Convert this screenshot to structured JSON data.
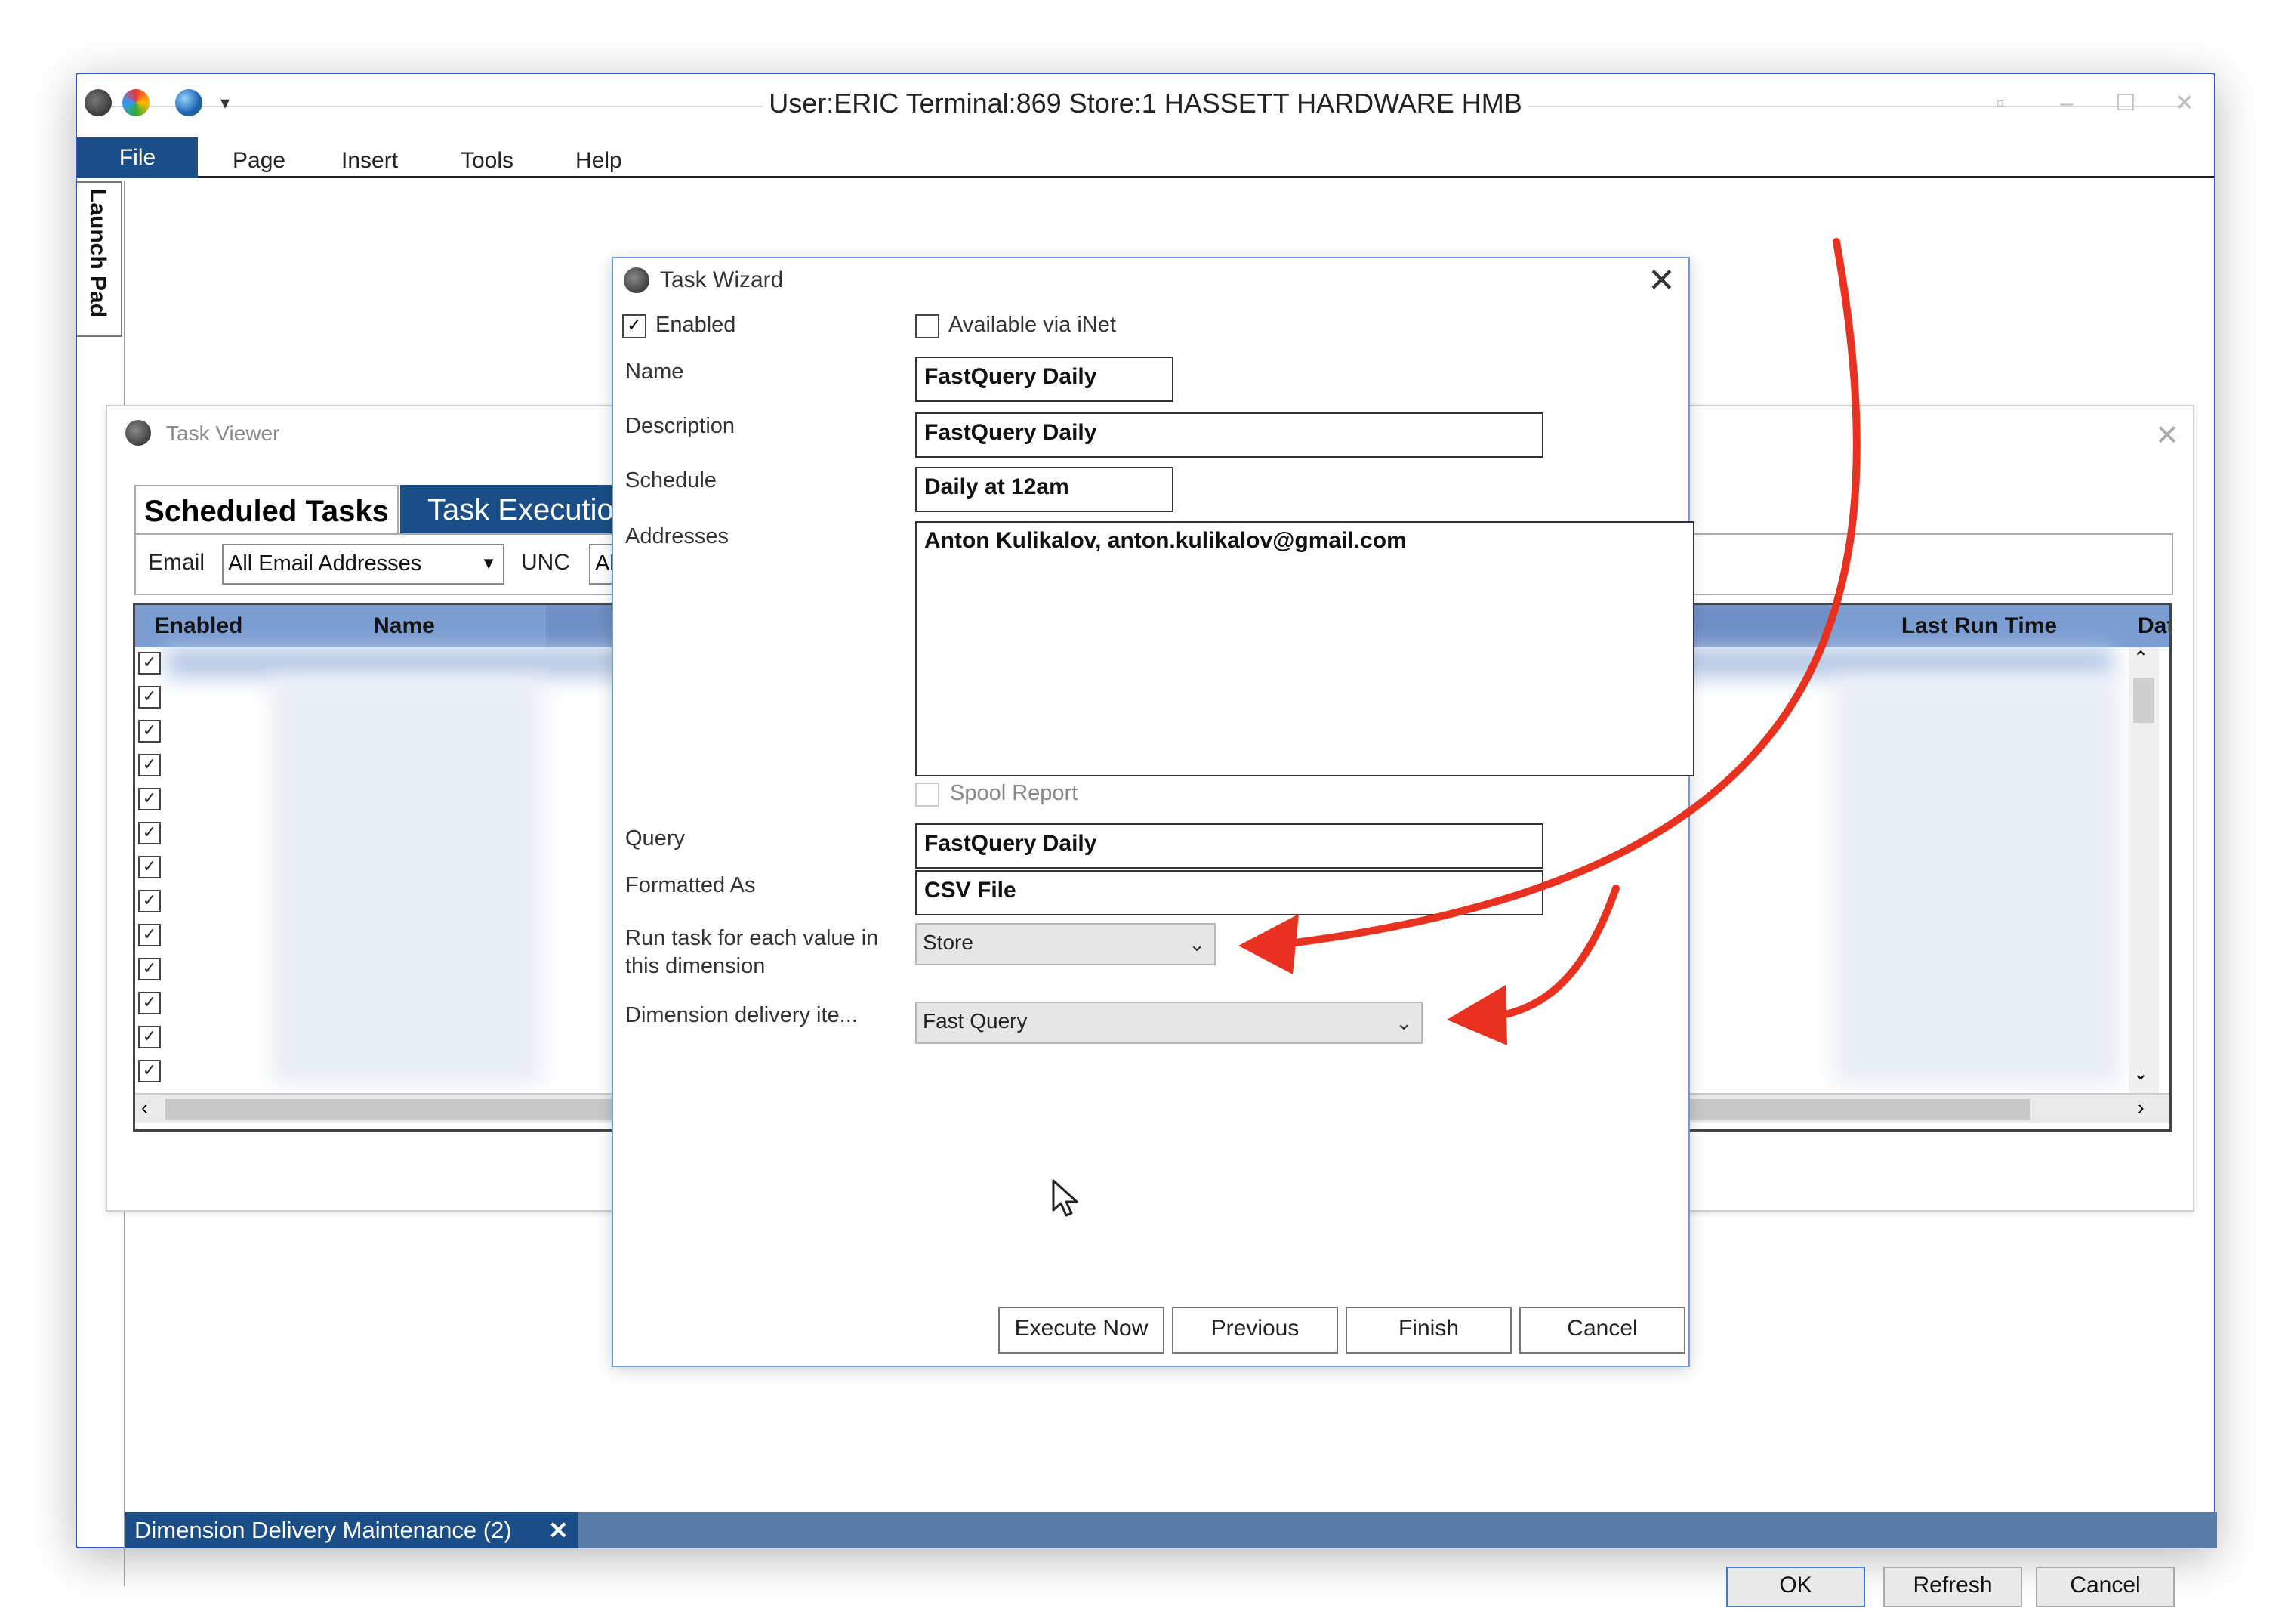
{
  "window": {
    "title": "User:ERIC Terminal:869 Store:1 HASSETT HARDWARE HMB",
    "quick_access_icons": [
      "app-orb-icon",
      "color-wheel-icon",
      "globe-icon",
      "dropdown-icon"
    ]
  },
  "menu": {
    "file": "File",
    "items": [
      "Page",
      "Insert",
      "Tools",
      "Help"
    ]
  },
  "launch_pad": "Launch Pad",
  "task_viewer": {
    "title": "Task Viewer",
    "tabs": [
      "Scheduled Tasks",
      "Task Execution"
    ],
    "filters": {
      "email_label": "Email",
      "email_value": "All Email Addresses",
      "unc_label": "UNC",
      "unc_value": "All"
    },
    "columns": [
      "Enabled",
      "Name",
      "Last Run Time",
      "Date"
    ],
    "rows_checked": [
      true,
      true,
      true,
      true,
      true,
      true,
      true,
      true,
      true,
      true,
      true,
      true,
      true
    ],
    "buttons": {
      "ok": "OK",
      "refresh": "Refresh",
      "cancel": "Cancel"
    }
  },
  "task_wizard": {
    "title": "Task Wizard",
    "enabled_label": "Enabled",
    "enabled_checked": true,
    "inet_label": "Available via iNet",
    "inet_checked": false,
    "name_label": "Name",
    "name_value": "FastQuery Daily",
    "description_label": "Description",
    "description_value": "FastQuery Daily",
    "schedule_label": "Schedule",
    "schedule_value": "Daily at 12am",
    "addresses_label": "Addresses",
    "addresses_value": "Anton Kulikalov, anton.kulikalov@gmail.com",
    "spool_label": "Spool Report",
    "spool_checked": false,
    "query_label": "Query",
    "query_value": "FastQuery Daily",
    "formatted_label": "Formatted As",
    "formatted_value": "CSV File",
    "run_each_label_1": "Run task for each value in",
    "run_each_label_2": "this dimension",
    "run_each_value": "Store",
    "dim_delivery_label": "Dimension delivery ite...",
    "dim_delivery_value": "Fast Query",
    "buttons": {
      "execute_now": "Execute Now",
      "previous": "Previous",
      "finish": "Finish",
      "cancel": "Cancel"
    }
  },
  "doc_tab": {
    "label": "Dimension Delivery Maintenance (2)",
    "close": "✕"
  },
  "annotation_color": "#e8321f",
  "accent_color": "#1b4e86"
}
